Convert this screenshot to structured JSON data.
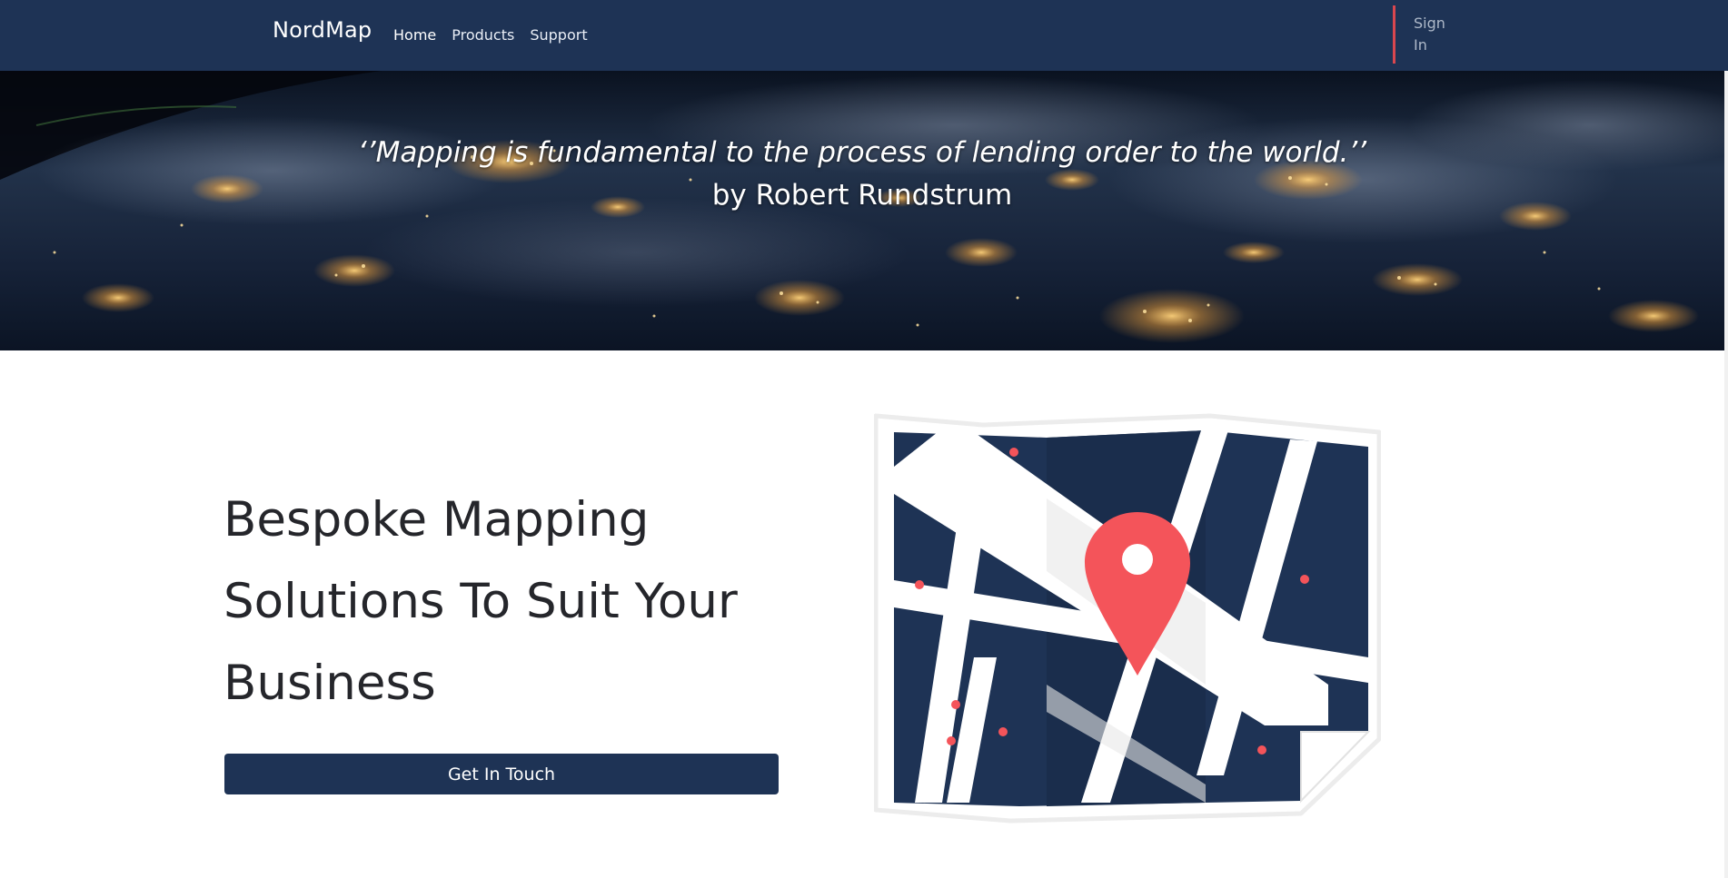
{
  "nav": {
    "brand": "NordMap",
    "links": [
      "Home",
      "Products",
      "Support"
    ],
    "signin": "Sign In"
  },
  "hero": {
    "quote": "‘’Mapping is fundamental to the process of lending order to the world.’’",
    "author": "by Robert Rundstrum"
  },
  "main": {
    "headline": "Bespoke Mapping Solutions To Suit Your Business",
    "cta": "Get In Touch"
  },
  "colors": {
    "navy": "#1e3355",
    "accent_red": "#f4545a"
  }
}
